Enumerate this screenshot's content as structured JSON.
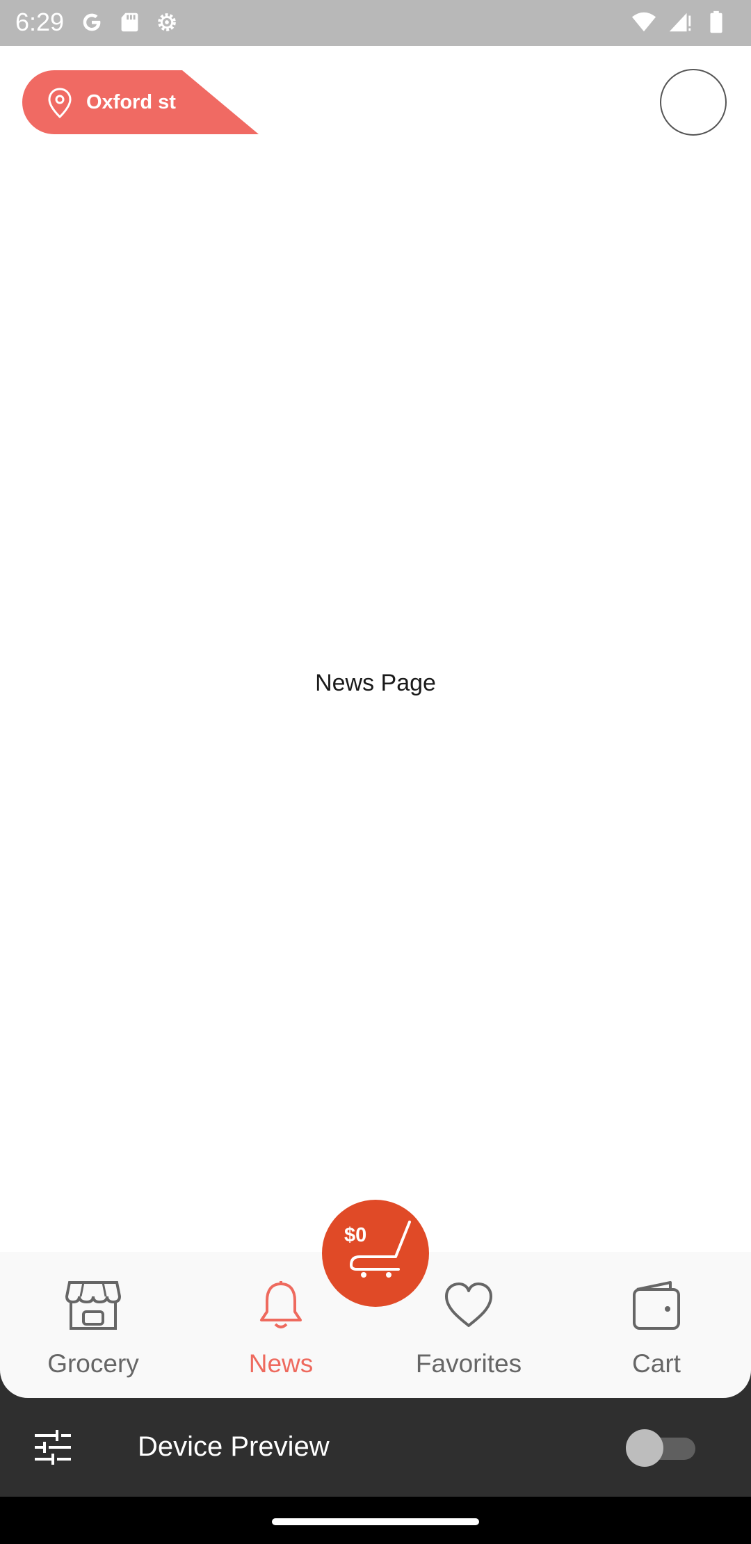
{
  "status_bar": {
    "time": "6:29",
    "left_icons": [
      "google-icon",
      "sd-card-icon",
      "settings-icon"
    ],
    "right_icons": [
      "wifi-icon",
      "signal-icon",
      "battery-icon"
    ]
  },
  "header": {
    "location": "Oxford st",
    "location_icon": "location-pin-icon",
    "chip_color": "#f06a63"
  },
  "main": {
    "page_label": "News Page"
  },
  "cart_fab": {
    "amount": "$0",
    "icon": "cart-icon",
    "color": "#e04a27"
  },
  "bottom_nav": {
    "active": "News",
    "accent": "#ee6a5e",
    "items": [
      {
        "label": "Grocery",
        "icon": "store-icon"
      },
      {
        "label": "News",
        "icon": "bell-icon"
      },
      {
        "label": "Favorites",
        "icon": "heart-icon"
      },
      {
        "label": "Cart",
        "icon": "wallet-icon"
      }
    ]
  },
  "device_preview": {
    "label": "Device Preview",
    "toggle_on": false
  }
}
